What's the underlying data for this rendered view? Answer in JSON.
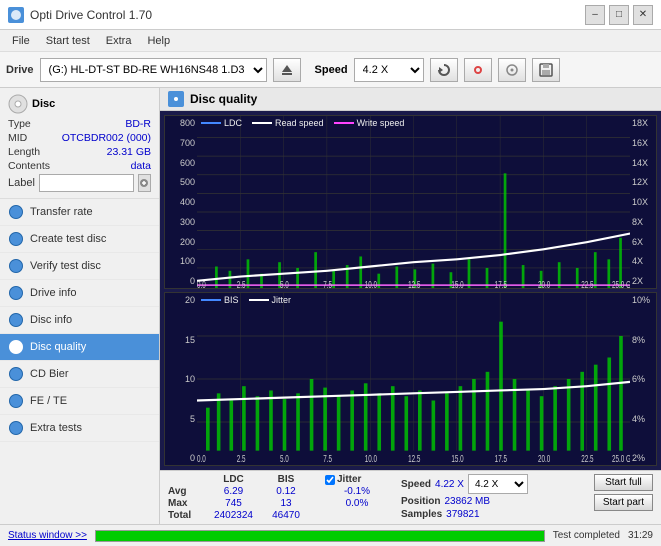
{
  "titlebar": {
    "title": "Opti Drive Control 1.70",
    "icon": "ODC",
    "min_btn": "–",
    "max_btn": "□",
    "close_btn": "✕"
  },
  "menubar": {
    "items": [
      "File",
      "Start test",
      "Extra",
      "Help"
    ]
  },
  "toolbar": {
    "drive_label": "Drive",
    "drive_value": "(G:)  HL-DT-ST BD-RE  WH16NS48 1.D3",
    "speed_label": "Speed",
    "speed_value": "4.2 X"
  },
  "sidebar": {
    "disc": {
      "type_label": "Type",
      "type_value": "BD-R",
      "mid_label": "MID",
      "mid_value": "OTCBDR002 (000)",
      "length_label": "Length",
      "length_value": "23.31 GB",
      "contents_label": "Contents",
      "contents_value": "data",
      "label_label": "Label"
    },
    "nav_items": [
      {
        "id": "transfer-rate",
        "label": "Transfer rate",
        "active": false
      },
      {
        "id": "create-test-disc",
        "label": "Create test disc",
        "active": false
      },
      {
        "id": "verify-test-disc",
        "label": "Verify test disc",
        "active": false
      },
      {
        "id": "drive-info",
        "label": "Drive info",
        "active": false
      },
      {
        "id": "disc-info",
        "label": "Disc info",
        "active": false
      },
      {
        "id": "disc-quality",
        "label": "Disc quality",
        "active": true
      },
      {
        "id": "cd-bier",
        "label": "CD Bier",
        "active": false
      },
      {
        "id": "fe-te",
        "label": "FE / TE",
        "active": false
      },
      {
        "id": "extra-tests",
        "label": "Extra tests",
        "active": false
      }
    ]
  },
  "disc_quality": {
    "title": "Disc quality",
    "chart1": {
      "legend": [
        {
          "label": "LDC",
          "color": "#4488ff"
        },
        {
          "label": "Read speed",
          "color": "#ffffff"
        },
        {
          "label": "Write speed",
          "color": "#ff44ff"
        }
      ],
      "y_labels_left": [
        "800",
        "700",
        "600",
        "500",
        "400",
        "300",
        "200",
        "100",
        "0"
      ],
      "y_labels_right": [
        "18X",
        "16X",
        "14X",
        "12X",
        "10X",
        "8X",
        "6X",
        "4X",
        "2X"
      ],
      "x_labels": [
        "0.0",
        "2.5",
        "5.0",
        "7.5",
        "10.0",
        "12.5",
        "15.0",
        "17.5",
        "20.0",
        "22.5",
        "25.0 GB"
      ]
    },
    "chart2": {
      "legend": [
        {
          "label": "BIS",
          "color": "#4488ff"
        },
        {
          "label": "Jitter",
          "color": "#ffffff"
        }
      ],
      "y_labels_left": [
        "20",
        "15",
        "10",
        "5",
        "0"
      ],
      "y_labels_right": [
        "10%",
        "8%",
        "6%",
        "4%",
        "2%"
      ],
      "x_labels": [
        "0.0",
        "2.5",
        "5.0",
        "7.5",
        "10.0",
        "12.5",
        "15.0",
        "17.5",
        "20.0",
        "22.5",
        "25.0 GB"
      ]
    }
  },
  "stats": {
    "headers": [
      "LDC",
      "BIS",
      "",
      "Jitter",
      "Speed"
    ],
    "avg_label": "Avg",
    "avg_ldc": "6.29",
    "avg_bis": "0.12",
    "avg_jitter": "-0.1%",
    "max_label": "Max",
    "max_ldc": "745",
    "max_bis": "13",
    "max_jitter": "0.0%",
    "total_label": "Total",
    "total_ldc": "2402324",
    "total_bis": "46470",
    "speed_label": "Speed",
    "speed_value": "4.22 X",
    "speed_select": "4.2 X",
    "position_label": "Position",
    "position_value": "23862 MB",
    "samples_label": "Samples",
    "samples_value": "379821",
    "start_full_label": "Start full",
    "start_part_label": "Start part",
    "jitter_checked": true,
    "jitter_label": "Jitter"
  },
  "statusbar": {
    "window_btn": "Status window >>",
    "progress": 100,
    "status_text": "Test completed",
    "time": "31:29"
  }
}
